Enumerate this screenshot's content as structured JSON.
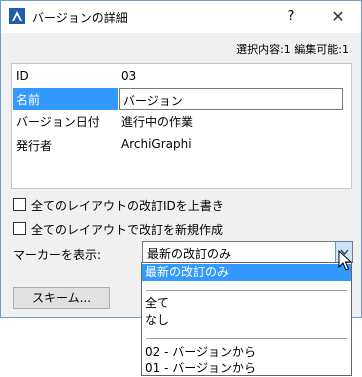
{
  "window": {
    "title": "バージョンの詳細",
    "help_label": "?",
    "close_label": "✕"
  },
  "status": {
    "text": "選択内容:1 編集可能:1"
  },
  "properties": [
    {
      "key": "ID",
      "value": "03",
      "selected": false
    },
    {
      "key": "名前",
      "value": "バージョン",
      "selected": true
    },
    {
      "key": "バージョン日付",
      "value": "進行中の作業",
      "selected": false
    },
    {
      "key": "発行者",
      "value": "ArchiGraphi",
      "selected": false
    }
  ],
  "options": {
    "overwrite_label": "全てのレイアウトの改訂IDを上書き",
    "new_revision_label": "全てのレイアウトで改訂を新規作成",
    "overwrite_checked": false,
    "new_revision_checked": false
  },
  "marker": {
    "label": "マーカーを表示:",
    "selected_value": "最新の改訂のみ",
    "options": [
      [
        "最新の改訂のみ"
      ],
      [
        "全て",
        "なし"
      ],
      [
        "02 - バージョンから",
        "01 - バージョンから"
      ]
    ],
    "highlighted_option": "最新の改訂のみ"
  },
  "buttons": {
    "scheme_label": "スキーム..."
  },
  "colors": {
    "selection": "#3399ff",
    "window_border": "#6e9bd1",
    "dialog_bg": "#f0f0f0"
  },
  "icons": {
    "app": "archicad-icon",
    "dropdown_arrow": "chevron-down-icon",
    "cursor": "mouse-pointer-icon"
  }
}
